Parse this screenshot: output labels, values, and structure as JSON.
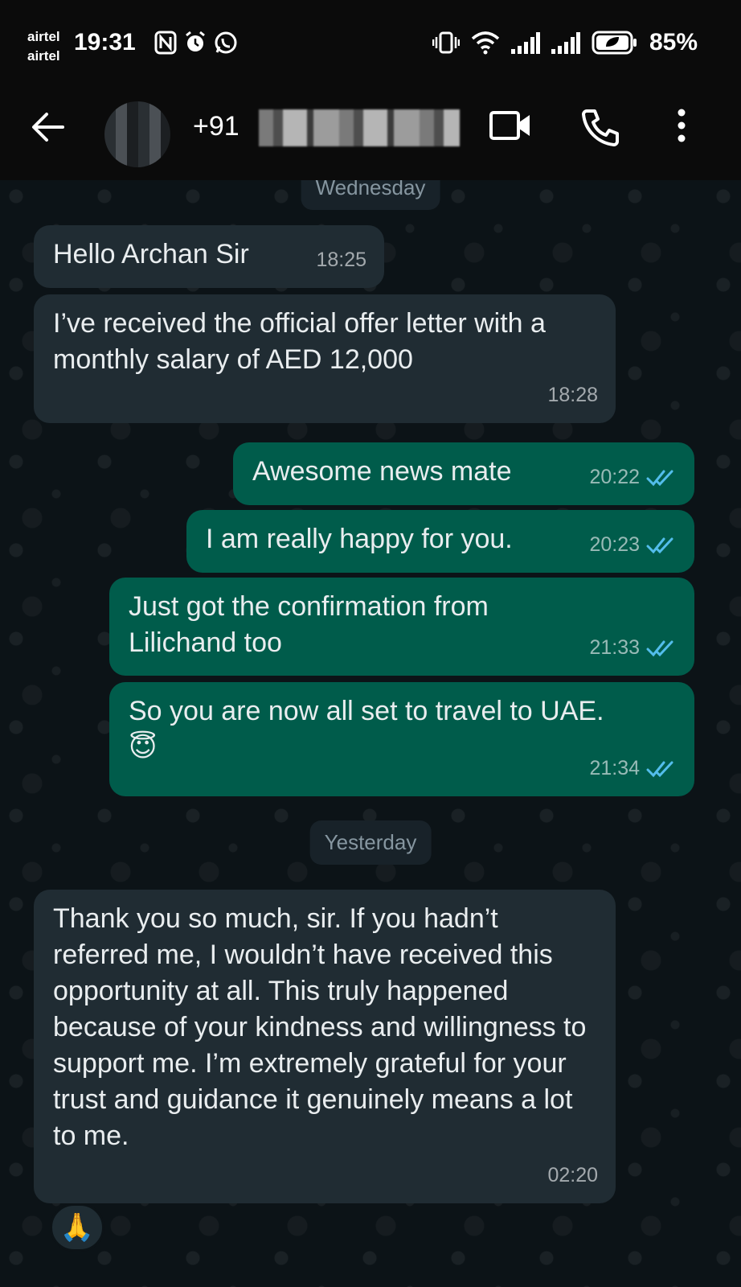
{
  "status_bar": {
    "carrier_1": "airtel",
    "carrier_2": "airtel",
    "time": "19:31",
    "battery": "85%"
  },
  "header": {
    "contact_prefix": "+91"
  },
  "chat": {
    "day_dividers": [
      "Wednesday",
      "Yesterday"
    ],
    "messages": [
      {
        "direction": "in",
        "text": "Hello Archan Sir",
        "time": "18:25"
      },
      {
        "direction": "in",
        "text": "I’ve received the official offer letter with a monthly salary of AED 12,000",
        "time": "18:28"
      },
      {
        "direction": "out",
        "text": "Awesome news mate",
        "time": "20:22",
        "read": true
      },
      {
        "direction": "out",
        "text": "I am really happy for you.",
        "time": "20:23",
        "read": true
      },
      {
        "direction": "out",
        "text": "Just got the confirmation from Lilichand too",
        "time": "21:33",
        "read": true
      },
      {
        "direction": "out",
        "text": "So you are now all set to travel to UAE. 😇",
        "time": "21:34",
        "read": true
      },
      {
        "direction": "in",
        "text": "Thank you so much, sir. If you hadn’t referred me, I wouldn’t have received this opportunity at all. This truly happened because of your kindness and willingness to support me. I’m extremely grateful for your trust and guidance it genuinely means a lot to me.",
        "time": "02:20"
      }
    ],
    "reaction": "🙏"
  },
  "colors": {
    "incoming_bubble": "#202c33",
    "outgoing_bubble": "#005c4b",
    "read_tick": "#53bdeb",
    "chat_background": "#0c1317"
  }
}
